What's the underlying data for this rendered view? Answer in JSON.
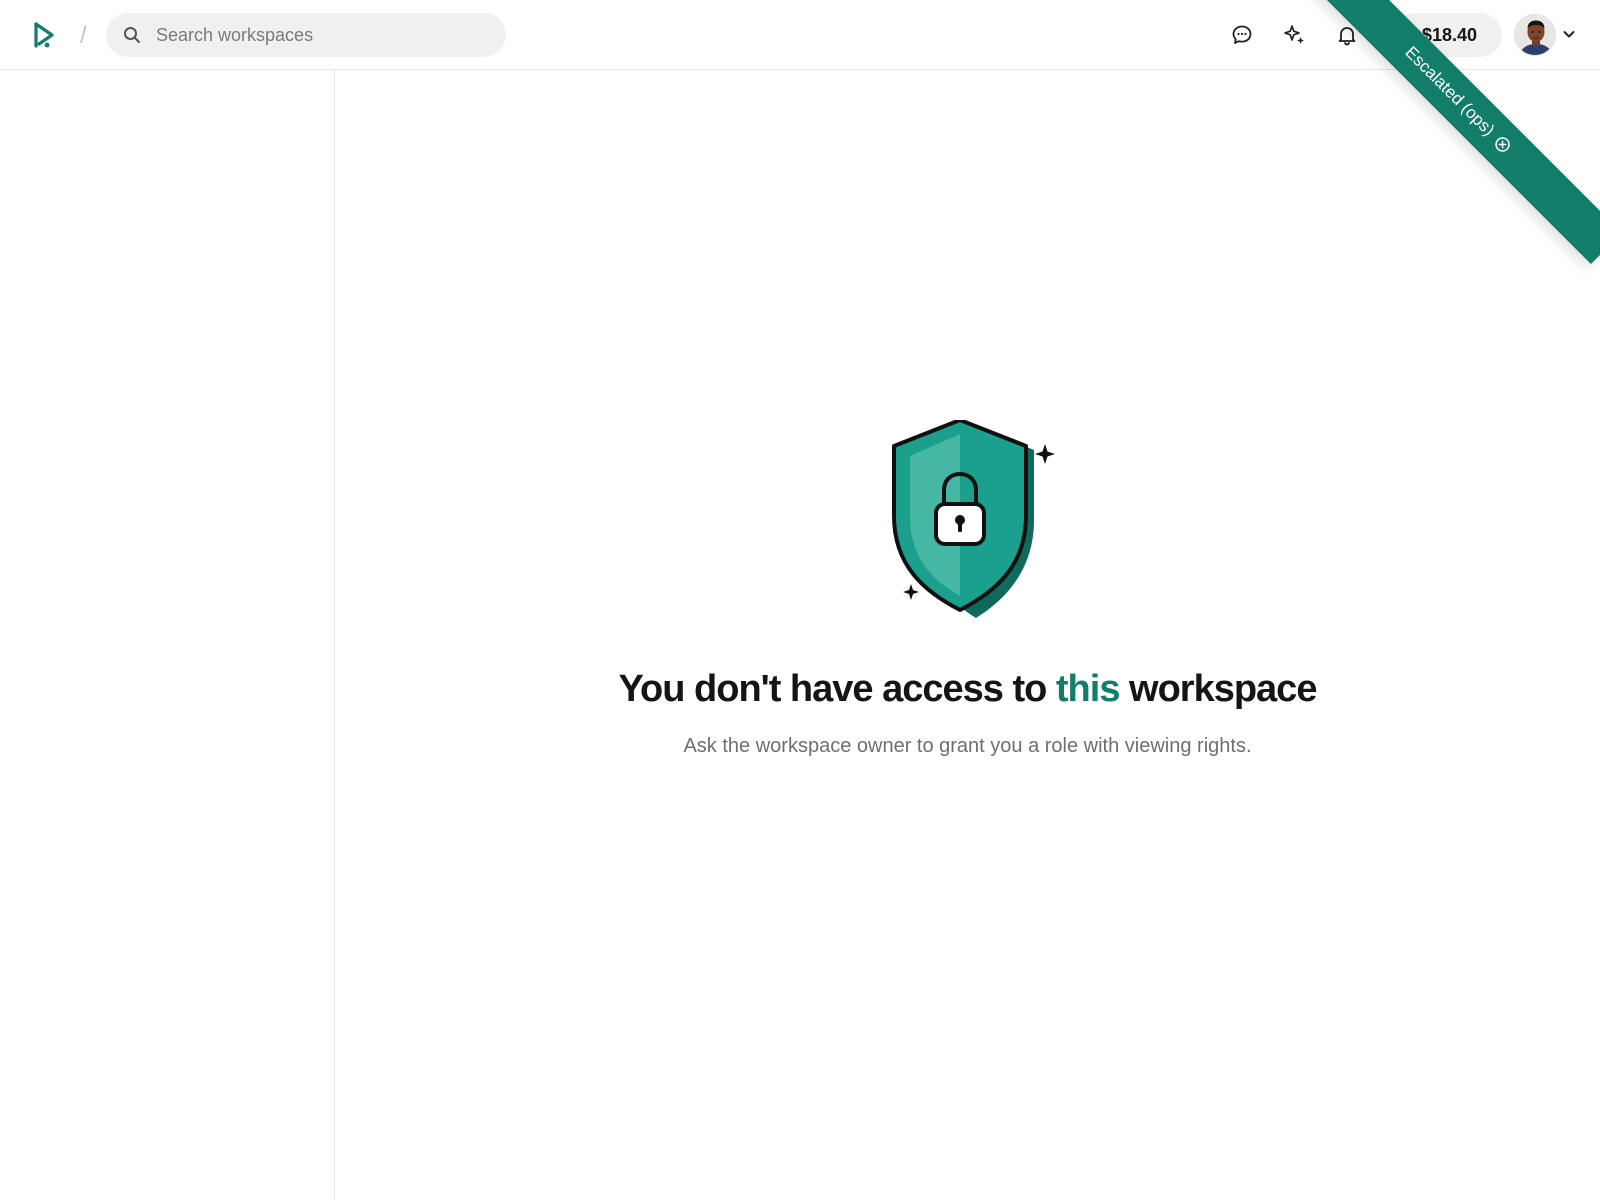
{
  "header": {
    "search": {
      "placeholder": "Search workspaces"
    },
    "separator": "/",
    "balance": "$18.40",
    "icons": {
      "logo": "play-logo-icon",
      "search": "search-icon",
      "chat": "chat-bubble-icon",
      "ai": "sparkle-icon",
      "notifications": "bell-icon",
      "account_menu": "chevron-down-icon"
    }
  },
  "ribbon": {
    "label": "Escalated (ops)",
    "icon": "close-circle-icon"
  },
  "main": {
    "illustration": "shield-lock-icon",
    "heading_before": "You don't have access to ",
    "heading_accent": "this",
    "heading_after": " workspace",
    "subtext": "Ask the workspace owner to grant you a role with viewing rights."
  },
  "colors": {
    "accent": "#127d69",
    "shield_primary": "#1aa08c",
    "shield_dark": "#0e6a5a",
    "divider": "#e4e4e2",
    "search_bg": "#f0f0ee"
  }
}
